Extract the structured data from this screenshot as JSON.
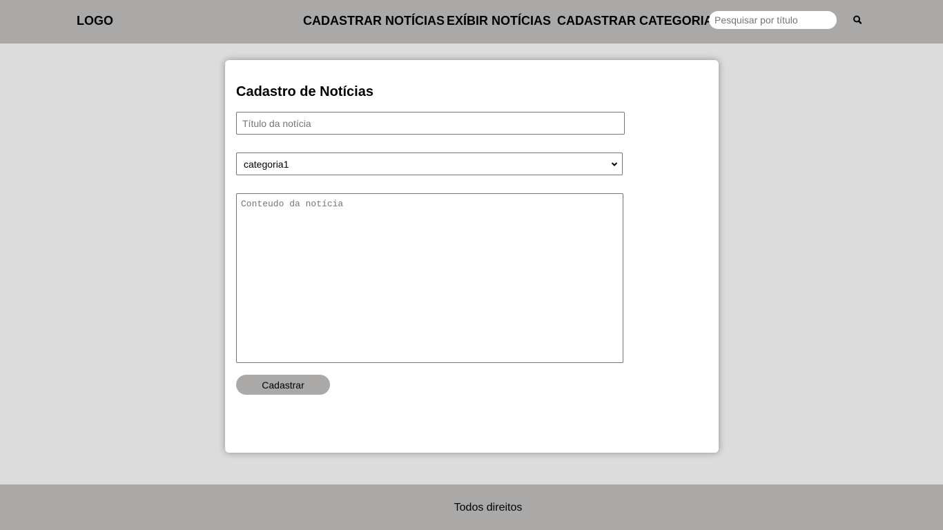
{
  "header": {
    "logo": "LOGO",
    "nav": [
      {
        "label": "CADASTRAR NOTÍCIAS"
      },
      {
        "label": "EXÍBIR NOTÍCIAS"
      },
      {
        "label": "CADASTRAR CATEGORIA"
      }
    ],
    "search": {
      "placeholder": "Pesquisar por título",
      "value": "",
      "icon": "search-icon"
    }
  },
  "form": {
    "title": "Cadastro de Notícias",
    "title_input": {
      "placeholder": "Título da notícia",
      "value": ""
    },
    "category_select": {
      "selected": "categoria1",
      "icon": "chevron-down-icon"
    },
    "content_textarea": {
      "placeholder": "Conteudo da notícia",
      "value": ""
    },
    "submit_label": "Cadastrar"
  },
  "footer": {
    "text": "Todos direitos"
  },
  "colors": {
    "header_bg": "#aaa9a7",
    "page_bg": "#dcdcdc",
    "card_bg": "#ffffff",
    "button_bg": "#aaa9a7"
  }
}
